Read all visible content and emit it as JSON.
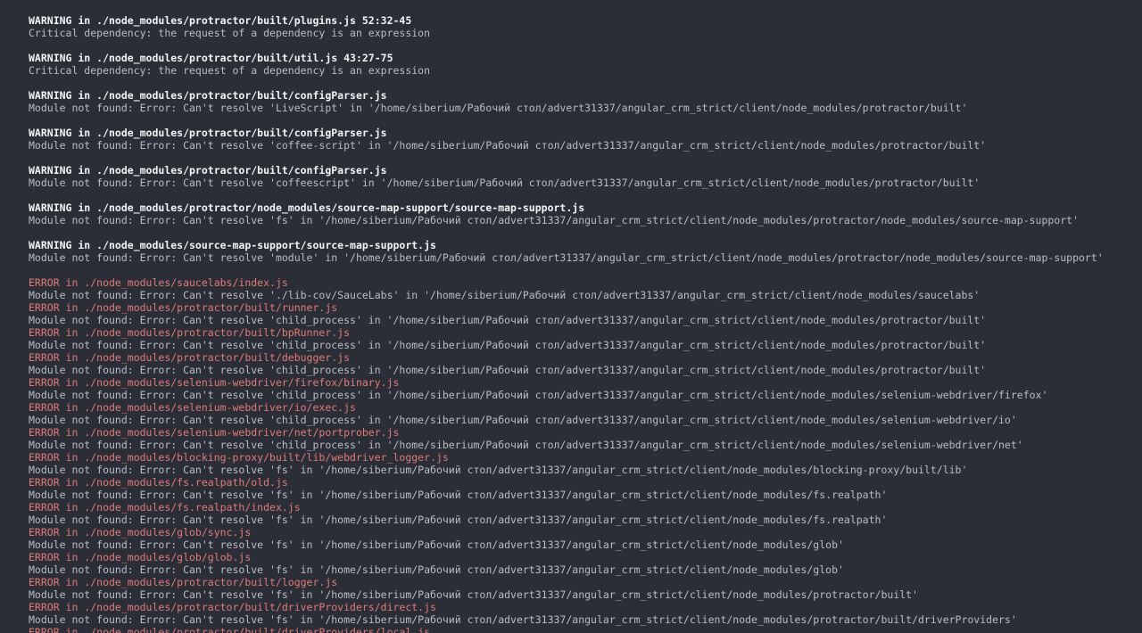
{
  "colors": {
    "background": "#2b2e36",
    "warning_text": "#f3f4f6",
    "error_text": "#e07a7a",
    "message_text": "#b9bdc5"
  },
  "lines": [
    {
      "kind": "warning",
      "text": "WARNING in ./node_modules/protractor/built/plugins.js 52:32-45"
    },
    {
      "kind": "msg",
      "text": "Critical dependency: the request of a dependency is an expression"
    },
    {
      "kind": "blank",
      "text": ""
    },
    {
      "kind": "warning",
      "text": "WARNING in ./node_modules/protractor/built/util.js 43:27-75"
    },
    {
      "kind": "msg",
      "text": "Critical dependency: the request of a dependency is an expression"
    },
    {
      "kind": "blank",
      "text": ""
    },
    {
      "kind": "warning",
      "text": "WARNING in ./node_modules/protractor/built/configParser.js"
    },
    {
      "kind": "msg",
      "text": "Module not found: Error: Can't resolve 'LiveScript' in '/home/siberium/Рабочий стол/advert31337/angular_crm_strict/client/node_modules/protractor/built'"
    },
    {
      "kind": "blank",
      "text": ""
    },
    {
      "kind": "warning",
      "text": "WARNING in ./node_modules/protractor/built/configParser.js"
    },
    {
      "kind": "msg",
      "text": "Module not found: Error: Can't resolve 'coffee-script' in '/home/siberium/Рабочий стол/advert31337/angular_crm_strict/client/node_modules/protractor/built'"
    },
    {
      "kind": "blank",
      "text": ""
    },
    {
      "kind": "warning",
      "text": "WARNING in ./node_modules/protractor/built/configParser.js"
    },
    {
      "kind": "msg",
      "text": "Module not found: Error: Can't resolve 'coffeescript' in '/home/siberium/Рабочий стол/advert31337/angular_crm_strict/client/node_modules/protractor/built'"
    },
    {
      "kind": "blank",
      "text": ""
    },
    {
      "kind": "warning",
      "text": "WARNING in ./node_modules/protractor/node_modules/source-map-support/source-map-support.js"
    },
    {
      "kind": "msg",
      "text": "Module not found: Error: Can't resolve 'fs' in '/home/siberium/Рабочий стол/advert31337/angular_crm_strict/client/node_modules/protractor/node_modules/source-map-support'"
    },
    {
      "kind": "blank",
      "text": ""
    },
    {
      "kind": "warning",
      "text": "WARNING in ./node_modules/source-map-support/source-map-support.js"
    },
    {
      "kind": "msg",
      "text": "Module not found: Error: Can't resolve 'module' in '/home/siberium/Рабочий стол/advert31337/angular_crm_strict/client/node_modules/protractor/node_modules/source-map-support'"
    },
    {
      "kind": "blank",
      "text": ""
    },
    {
      "kind": "error",
      "text": "ERROR in ./node_modules/saucelabs/index.js"
    },
    {
      "kind": "msg",
      "text": "Module not found: Error: Can't resolve './lib-cov/SauceLabs' in '/home/siberium/Рабочий стол/advert31337/angular_crm_strict/client/node_modules/saucelabs'"
    },
    {
      "kind": "error",
      "text": "ERROR in ./node_modules/protractor/built/runner.js"
    },
    {
      "kind": "msg",
      "text": "Module not found: Error: Can't resolve 'child_process' in '/home/siberium/Рабочий стол/advert31337/angular_crm_strict/client/node_modules/protractor/built'"
    },
    {
      "kind": "error",
      "text": "ERROR in ./node_modules/protractor/built/bpRunner.js"
    },
    {
      "kind": "msg",
      "text": "Module not found: Error: Can't resolve 'child_process' in '/home/siberium/Рабочий стол/advert31337/angular_crm_strict/client/node_modules/protractor/built'"
    },
    {
      "kind": "error",
      "text": "ERROR in ./node_modules/protractor/built/debugger.js"
    },
    {
      "kind": "msg",
      "text": "Module not found: Error: Can't resolve 'child_process' in '/home/siberium/Рабочий стол/advert31337/angular_crm_strict/client/node_modules/protractor/built'"
    },
    {
      "kind": "error",
      "text": "ERROR in ./node_modules/selenium-webdriver/firefox/binary.js"
    },
    {
      "kind": "msg",
      "text": "Module not found: Error: Can't resolve 'child_process' in '/home/siberium/Рабочий стол/advert31337/angular_crm_strict/client/node_modules/selenium-webdriver/firefox'"
    },
    {
      "kind": "error",
      "text": "ERROR in ./node_modules/selenium-webdriver/io/exec.js"
    },
    {
      "kind": "msg",
      "text": "Module not found: Error: Can't resolve 'child_process' in '/home/siberium/Рабочий стол/advert31337/angular_crm_strict/client/node_modules/selenium-webdriver/io'"
    },
    {
      "kind": "error",
      "text": "ERROR in ./node_modules/selenium-webdriver/net/portprober.js"
    },
    {
      "kind": "msg",
      "text": "Module not found: Error: Can't resolve 'child_process' in '/home/siberium/Рабочий стол/advert31337/angular_crm_strict/client/node_modules/selenium-webdriver/net'"
    },
    {
      "kind": "error",
      "text": "ERROR in ./node_modules/blocking-proxy/built/lib/webdriver_logger.js"
    },
    {
      "kind": "msg",
      "text": "Module not found: Error: Can't resolve 'fs' in '/home/siberium/Рабочий стол/advert31337/angular_crm_strict/client/node_modules/blocking-proxy/built/lib'"
    },
    {
      "kind": "error",
      "text": "ERROR in ./node_modules/fs.realpath/old.js"
    },
    {
      "kind": "msg",
      "text": "Module not found: Error: Can't resolve 'fs' in '/home/siberium/Рабочий стол/advert31337/angular_crm_strict/client/node_modules/fs.realpath'"
    },
    {
      "kind": "error",
      "text": "ERROR in ./node_modules/fs.realpath/index.js"
    },
    {
      "kind": "msg",
      "text": "Module not found: Error: Can't resolve 'fs' in '/home/siberium/Рабочий стол/advert31337/angular_crm_strict/client/node_modules/fs.realpath'"
    },
    {
      "kind": "error",
      "text": "ERROR in ./node_modules/glob/sync.js"
    },
    {
      "kind": "msg",
      "text": "Module not found: Error: Can't resolve 'fs' in '/home/siberium/Рабочий стол/advert31337/angular_crm_strict/client/node_modules/glob'"
    },
    {
      "kind": "error",
      "text": "ERROR in ./node_modules/glob/glob.js"
    },
    {
      "kind": "msg",
      "text": "Module not found: Error: Can't resolve 'fs' in '/home/siberium/Рабочий стол/advert31337/angular_crm_strict/client/node_modules/glob'"
    },
    {
      "kind": "error",
      "text": "ERROR in ./node_modules/protractor/built/logger.js"
    },
    {
      "kind": "msg",
      "text": "Module not found: Error: Can't resolve 'fs' in '/home/siberium/Рабочий стол/advert31337/angular_crm_strict/client/node_modules/protractor/built'"
    },
    {
      "kind": "error",
      "text": "ERROR in ./node_modules/protractor/built/driverProviders/direct.js"
    },
    {
      "kind": "msg",
      "text": "Module not found: Error: Can't resolve 'fs' in '/home/siberium/Рабочий стол/advert31337/angular_crm_strict/client/node_modules/protractor/built/driverProviders'"
    },
    {
      "kind": "error",
      "text": "ERROR in ./node_modules/protractor/built/driverProviders/local.js"
    }
  ]
}
